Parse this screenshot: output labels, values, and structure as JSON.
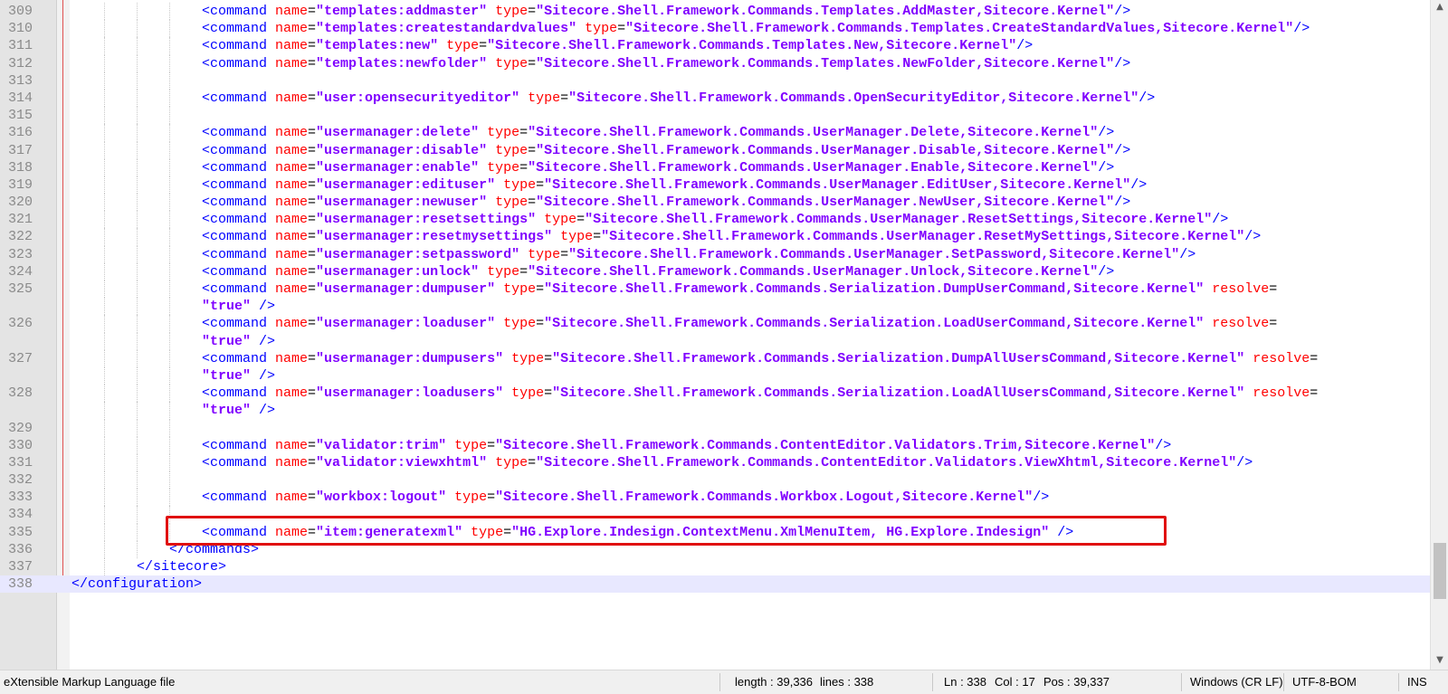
{
  "editor": {
    "lines": [
      {
        "n": "309",
        "indent": 4,
        "parts": [
          [
            "t",
            "<command "
          ],
          [
            "a",
            "name"
          ],
          [
            "e",
            "="
          ],
          [
            "v",
            "\"templates:addmaster\""
          ],
          [
            "e",
            " "
          ],
          [
            "a",
            "type"
          ],
          [
            "e",
            "="
          ],
          [
            "v",
            "\"Sitecore.Shell.Framework.Commands.Templates.AddMaster,Sitecore.Kernel\""
          ],
          [
            "t",
            "/>"
          ]
        ]
      },
      {
        "n": "310",
        "indent": 4,
        "parts": [
          [
            "t",
            "<command "
          ],
          [
            "a",
            "name"
          ],
          [
            "e",
            "="
          ],
          [
            "v",
            "\"templates:createstandardvalues\""
          ],
          [
            "e",
            " "
          ],
          [
            "a",
            "type"
          ],
          [
            "e",
            "="
          ],
          [
            "v",
            "\"Sitecore.Shell.Framework.Commands.Templates.CreateStandardValues,Sitecore.Kernel\""
          ],
          [
            "t",
            "/>"
          ]
        ]
      },
      {
        "n": "311",
        "indent": 4,
        "parts": [
          [
            "t",
            "<command "
          ],
          [
            "a",
            "name"
          ],
          [
            "e",
            "="
          ],
          [
            "v",
            "\"templates:new\""
          ],
          [
            "e",
            " "
          ],
          [
            "a",
            "type"
          ],
          [
            "e",
            "="
          ],
          [
            "v",
            "\"Sitecore.Shell.Framework.Commands.Templates.New,Sitecore.Kernel\""
          ],
          [
            "t",
            "/>"
          ]
        ]
      },
      {
        "n": "312",
        "indent": 4,
        "parts": [
          [
            "t",
            "<command "
          ],
          [
            "a",
            "name"
          ],
          [
            "e",
            "="
          ],
          [
            "v",
            "\"templates:newfolder\""
          ],
          [
            "e",
            " "
          ],
          [
            "a",
            "type"
          ],
          [
            "e",
            "="
          ],
          [
            "v",
            "\"Sitecore.Shell.Framework.Commands.Templates.NewFolder,Sitecore.Kernel\""
          ],
          [
            "t",
            "/>"
          ]
        ]
      },
      {
        "n": "313",
        "indent": 4,
        "parts": []
      },
      {
        "n": "314",
        "indent": 4,
        "parts": [
          [
            "t",
            "<command "
          ],
          [
            "a",
            "name"
          ],
          [
            "e",
            "="
          ],
          [
            "v",
            "\"user:opensecurityeditor\""
          ],
          [
            "e",
            " "
          ],
          [
            "a",
            "type"
          ],
          [
            "e",
            "="
          ],
          [
            "v",
            "\"Sitecore.Shell.Framework.Commands.OpenSecurityEditor,Sitecore.Kernel\""
          ],
          [
            "t",
            "/>"
          ]
        ]
      },
      {
        "n": "315",
        "indent": 4,
        "parts": []
      },
      {
        "n": "316",
        "indent": 4,
        "parts": [
          [
            "t",
            "<command "
          ],
          [
            "a",
            "name"
          ],
          [
            "e",
            "="
          ],
          [
            "v",
            "\"usermanager:delete\""
          ],
          [
            "e",
            " "
          ],
          [
            "a",
            "type"
          ],
          [
            "e",
            "="
          ],
          [
            "v",
            "\"Sitecore.Shell.Framework.Commands.UserManager.Delete,Sitecore.Kernel\""
          ],
          [
            "t",
            "/>"
          ]
        ]
      },
      {
        "n": "317",
        "indent": 4,
        "parts": [
          [
            "t",
            "<command "
          ],
          [
            "a",
            "name"
          ],
          [
            "e",
            "="
          ],
          [
            "v",
            "\"usermanager:disable\""
          ],
          [
            "e",
            " "
          ],
          [
            "a",
            "type"
          ],
          [
            "e",
            "="
          ],
          [
            "v",
            "\"Sitecore.Shell.Framework.Commands.UserManager.Disable,Sitecore.Kernel\""
          ],
          [
            "t",
            "/>"
          ]
        ]
      },
      {
        "n": "318",
        "indent": 4,
        "parts": [
          [
            "t",
            "<command "
          ],
          [
            "a",
            "name"
          ],
          [
            "e",
            "="
          ],
          [
            "v",
            "\"usermanager:enable\""
          ],
          [
            "e",
            " "
          ],
          [
            "a",
            "type"
          ],
          [
            "e",
            "="
          ],
          [
            "v",
            "\"Sitecore.Shell.Framework.Commands.UserManager.Enable,Sitecore.Kernel\""
          ],
          [
            "t",
            "/>"
          ]
        ]
      },
      {
        "n": "319",
        "indent": 4,
        "parts": [
          [
            "t",
            "<command "
          ],
          [
            "a",
            "name"
          ],
          [
            "e",
            "="
          ],
          [
            "v",
            "\"usermanager:edituser\""
          ],
          [
            "e",
            " "
          ],
          [
            "a",
            "type"
          ],
          [
            "e",
            "="
          ],
          [
            "v",
            "\"Sitecore.Shell.Framework.Commands.UserManager.EditUser,Sitecore.Kernel\""
          ],
          [
            "t",
            "/>"
          ]
        ]
      },
      {
        "n": "320",
        "indent": 4,
        "parts": [
          [
            "t",
            "<command "
          ],
          [
            "a",
            "name"
          ],
          [
            "e",
            "="
          ],
          [
            "v",
            "\"usermanager:newuser\""
          ],
          [
            "e",
            " "
          ],
          [
            "a",
            "type"
          ],
          [
            "e",
            "="
          ],
          [
            "v",
            "\"Sitecore.Shell.Framework.Commands.UserManager.NewUser,Sitecore.Kernel\""
          ],
          [
            "t",
            "/>"
          ]
        ]
      },
      {
        "n": "321",
        "indent": 4,
        "parts": [
          [
            "t",
            "<command "
          ],
          [
            "a",
            "name"
          ],
          [
            "e",
            "="
          ],
          [
            "v",
            "\"usermanager:resetsettings\""
          ],
          [
            "e",
            " "
          ],
          [
            "a",
            "type"
          ],
          [
            "e",
            "="
          ],
          [
            "v",
            "\"Sitecore.Shell.Framework.Commands.UserManager.ResetSettings,Sitecore.Kernel\""
          ],
          [
            "t",
            "/>"
          ]
        ]
      },
      {
        "n": "322",
        "indent": 4,
        "parts": [
          [
            "t",
            "<command "
          ],
          [
            "a",
            "name"
          ],
          [
            "e",
            "="
          ],
          [
            "v",
            "\"usermanager:resetmysettings\""
          ],
          [
            "e",
            " "
          ],
          [
            "a",
            "type"
          ],
          [
            "e",
            "="
          ],
          [
            "v",
            "\"Sitecore.Shell.Framework.Commands.UserManager.ResetMySettings,Sitecore.Kernel\""
          ],
          [
            "t",
            "/>"
          ]
        ]
      },
      {
        "n": "323",
        "indent": 4,
        "parts": [
          [
            "t",
            "<command "
          ],
          [
            "a",
            "name"
          ],
          [
            "e",
            "="
          ],
          [
            "v",
            "\"usermanager:setpassword\""
          ],
          [
            "e",
            " "
          ],
          [
            "a",
            "type"
          ],
          [
            "e",
            "="
          ],
          [
            "v",
            "\"Sitecore.Shell.Framework.Commands.UserManager.SetPassword,Sitecore.Kernel\""
          ],
          [
            "t",
            "/>"
          ]
        ]
      },
      {
        "n": "324",
        "indent": 4,
        "parts": [
          [
            "t",
            "<command "
          ],
          [
            "a",
            "name"
          ],
          [
            "e",
            "="
          ],
          [
            "v",
            "\"usermanager:unlock\""
          ],
          [
            "e",
            " "
          ],
          [
            "a",
            "type"
          ],
          [
            "e",
            "="
          ],
          [
            "v",
            "\"Sitecore.Shell.Framework.Commands.UserManager.Unlock,Sitecore.Kernel\""
          ],
          [
            "t",
            "/>"
          ]
        ]
      },
      {
        "n": "325",
        "indent": 4,
        "parts": [
          [
            "t",
            "<command "
          ],
          [
            "a",
            "name"
          ],
          [
            "e",
            "="
          ],
          [
            "v",
            "\"usermanager:dumpuser\""
          ],
          [
            "e",
            " "
          ],
          [
            "a",
            "type"
          ],
          [
            "e",
            "="
          ],
          [
            "v",
            "\"Sitecore.Shell.Framework.Commands.Serialization.DumpUserCommand,Sitecore.Kernel\""
          ],
          [
            "e",
            " "
          ],
          [
            "a",
            "resolve"
          ],
          [
            "e",
            "="
          ]
        ]
      },
      {
        "n": "",
        "indent": 4,
        "parts": [
          [
            "v",
            "\"true\""
          ],
          [
            "e",
            " "
          ],
          [
            "t",
            "/>"
          ]
        ]
      },
      {
        "n": "326",
        "indent": 4,
        "parts": [
          [
            "t",
            "<command "
          ],
          [
            "a",
            "name"
          ],
          [
            "e",
            "="
          ],
          [
            "v",
            "\"usermanager:loaduser\""
          ],
          [
            "e",
            " "
          ],
          [
            "a",
            "type"
          ],
          [
            "e",
            "="
          ],
          [
            "v",
            "\"Sitecore.Shell.Framework.Commands.Serialization.LoadUserCommand,Sitecore.Kernel\""
          ],
          [
            "e",
            " "
          ],
          [
            "a",
            "resolve"
          ],
          [
            "e",
            "="
          ]
        ]
      },
      {
        "n": "",
        "indent": 4,
        "parts": [
          [
            "v",
            "\"true\""
          ],
          [
            "e",
            " "
          ],
          [
            "t",
            "/>"
          ]
        ]
      },
      {
        "n": "327",
        "indent": 4,
        "parts": [
          [
            "t",
            "<command "
          ],
          [
            "a",
            "name"
          ],
          [
            "e",
            "="
          ],
          [
            "v",
            "\"usermanager:dumpusers\""
          ],
          [
            "e",
            " "
          ],
          [
            "a",
            "type"
          ],
          [
            "e",
            "="
          ],
          [
            "v",
            "\"Sitecore.Shell.Framework.Commands.Serialization.DumpAllUsersCommand,Sitecore.Kernel\""
          ],
          [
            "e",
            " "
          ],
          [
            "a",
            "resolve"
          ],
          [
            "e",
            "="
          ]
        ]
      },
      {
        "n": "",
        "indent": 4,
        "parts": [
          [
            "v",
            "\"true\""
          ],
          [
            "e",
            " "
          ],
          [
            "t",
            "/>"
          ]
        ]
      },
      {
        "n": "328",
        "indent": 4,
        "parts": [
          [
            "t",
            "<command "
          ],
          [
            "a",
            "name"
          ],
          [
            "e",
            "="
          ],
          [
            "v",
            "\"usermanager:loadusers\""
          ],
          [
            "e",
            " "
          ],
          [
            "a",
            "type"
          ],
          [
            "e",
            "="
          ],
          [
            "v",
            "\"Sitecore.Shell.Framework.Commands.Serialization.LoadAllUsersCommand,Sitecore.Kernel\""
          ],
          [
            "e",
            " "
          ],
          [
            "a",
            "resolve"
          ],
          [
            "e",
            "="
          ]
        ]
      },
      {
        "n": "",
        "indent": 4,
        "parts": [
          [
            "v",
            "\"true\""
          ],
          [
            "e",
            " "
          ],
          [
            "t",
            "/>"
          ]
        ]
      },
      {
        "n": "329",
        "indent": 4,
        "parts": []
      },
      {
        "n": "330",
        "indent": 4,
        "parts": [
          [
            "t",
            "<command "
          ],
          [
            "a",
            "name"
          ],
          [
            "e",
            "="
          ],
          [
            "v",
            "\"validator:trim\""
          ],
          [
            "e",
            " "
          ],
          [
            "a",
            "type"
          ],
          [
            "e",
            "="
          ],
          [
            "v",
            "\"Sitecore.Shell.Framework.Commands.ContentEditor.Validators.Trim,Sitecore.Kernel\""
          ],
          [
            "t",
            "/>"
          ]
        ]
      },
      {
        "n": "331",
        "indent": 4,
        "parts": [
          [
            "t",
            "<command "
          ],
          [
            "a",
            "name"
          ],
          [
            "e",
            "="
          ],
          [
            "v",
            "\"validator:viewxhtml\""
          ],
          [
            "e",
            " "
          ],
          [
            "a",
            "type"
          ],
          [
            "e",
            "="
          ],
          [
            "v",
            "\"Sitecore.Shell.Framework.Commands.ContentEditor.Validators.ViewXhtml,Sitecore.Kernel\""
          ],
          [
            "t",
            "/>"
          ]
        ]
      },
      {
        "n": "332",
        "indent": 4,
        "parts": []
      },
      {
        "n": "333",
        "indent": 4,
        "parts": [
          [
            "t",
            "<command "
          ],
          [
            "a",
            "name"
          ],
          [
            "e",
            "="
          ],
          [
            "v",
            "\"workbox:logout\""
          ],
          [
            "e",
            " "
          ],
          [
            "a",
            "type"
          ],
          [
            "e",
            "="
          ],
          [
            "v",
            "\"Sitecore.Shell.Framework.Commands.Workbox.Logout,Sitecore.Kernel\""
          ],
          [
            "t",
            "/>"
          ]
        ]
      },
      {
        "n": "334",
        "indent": 4,
        "parts": []
      },
      {
        "n": "335",
        "indent": 4,
        "parts": [
          [
            "t",
            "<command "
          ],
          [
            "a",
            "name"
          ],
          [
            "e",
            "="
          ],
          [
            "v",
            "\"item:generatexml\""
          ],
          [
            "e",
            " "
          ],
          [
            "a",
            "type"
          ],
          [
            "e",
            "="
          ],
          [
            "v",
            "\"HG.Explore.Indesign.ContextMenu.XmlMenuItem, HG.Explore.Indesign\""
          ],
          [
            "e",
            " "
          ],
          [
            "t",
            "/>"
          ]
        ]
      },
      {
        "n": "336",
        "indent": 3,
        "parts": [
          [
            "t",
            "</commands>"
          ]
        ]
      },
      {
        "n": "337",
        "indent": 2,
        "parts": [
          [
            "t",
            "</sitecore>"
          ]
        ]
      },
      {
        "n": "338",
        "indent": 0,
        "parts": [
          [
            "t",
            "</configuration>"
          ]
        ],
        "current": true
      }
    ]
  },
  "statusbar": {
    "file_type": "eXtensible Markup Language file",
    "length": "length : 39,336",
    "lines": "lines : 338",
    "ln": "Ln : 338",
    "col": "Col : 17",
    "pos": "Pos : 39,337",
    "eol": "Windows (CR LF)",
    "encoding": "UTF-8-BOM",
    "mode": "INS"
  }
}
